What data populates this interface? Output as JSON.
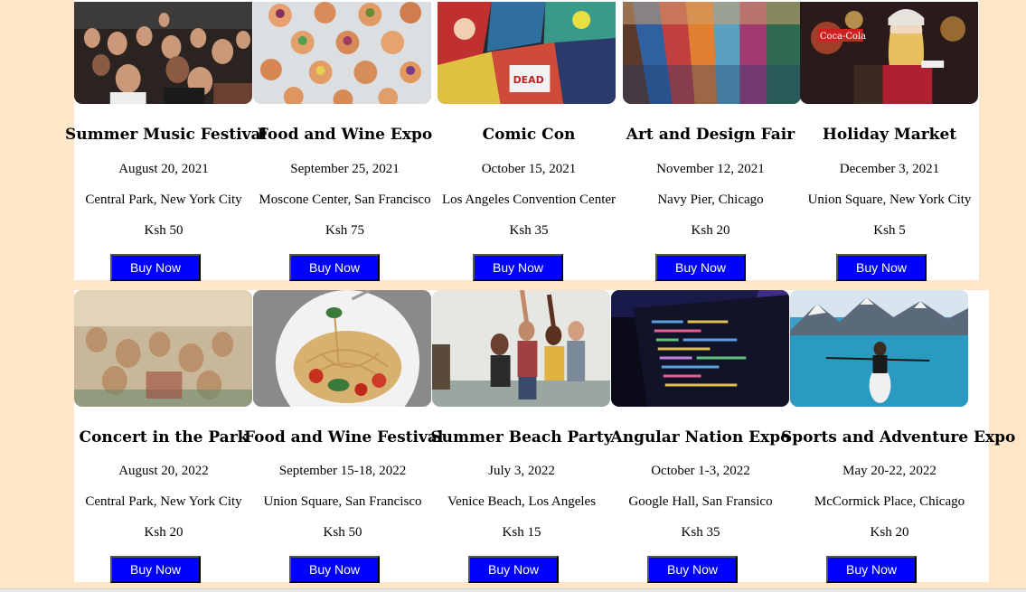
{
  "colors": {
    "page_background": "#ffe6c9",
    "card_background": "#ffffff",
    "button_background": "#0000ff",
    "button_text": "#ffffff"
  },
  "rows": [
    {
      "events": [
        {
          "title": "Summer Music Festival",
          "date": "August 20, 2021",
          "venue": "Central Park, New York City",
          "price": "Ksh 50",
          "button": "Buy Now",
          "image": "concert-crowd-image"
        },
        {
          "title": "Food and Wine Expo",
          "date": "September 25, 2021",
          "venue": "Moscone Center, San Francisco",
          "price": "Ksh 75",
          "button": "Buy Now",
          "image": "food-platters-image"
        },
        {
          "title": "Comic Con",
          "date": "October 15, 2021",
          "venue": "Los Angeles Convention Center",
          "price": "Ksh 35",
          "button": "Buy Now",
          "image": "comic-books-image"
        },
        {
          "title": "Art and Design Fair",
          "date": "November 12, 2021",
          "venue": "Navy Pier, Chicago",
          "price": "Ksh 20",
          "button": "Buy Now",
          "image": "paint-brushes-image"
        },
        {
          "title": "Holiday Market",
          "date": "December 3, 2021",
          "venue": "Union Square, New York City",
          "price": "Ksh 5",
          "button": "Buy Now",
          "image": "holiday-woman-image"
        }
      ]
    },
    {
      "events": [
        {
          "title": "Concert in the Park",
          "date": "August 20, 2022",
          "venue": "Central Park, New York City",
          "price": "Ksh 20",
          "button": "Buy Now",
          "image": "park-crowd-image"
        },
        {
          "title": "Food and Wine Festival",
          "date": "September 15-18, 2022",
          "venue": "Union Square, San Francisco",
          "price": "Ksh 50",
          "button": "Buy Now",
          "image": "pasta-plate-image"
        },
        {
          "title": "Summer Beach Party",
          "date": "July 3, 2022",
          "venue": "Venice Beach, Los Angeles",
          "price": "Ksh 15",
          "button": "Buy Now",
          "image": "beach-friends-image"
        },
        {
          "title": "Angular Nation Expo",
          "date": "October 1-3, 2022",
          "venue": "Google Hall, San Fransico",
          "price": "Ksh 35",
          "button": "Buy Now",
          "image": "code-screen-image"
        },
        {
          "title": "Sports and Adventure Expo",
          "date": "May 20-22, 2022",
          "venue": "McCormick Place, Chicago",
          "price": "Ksh 20",
          "button": "Buy Now",
          "image": "kayak-lake-image"
        }
      ]
    }
  ]
}
